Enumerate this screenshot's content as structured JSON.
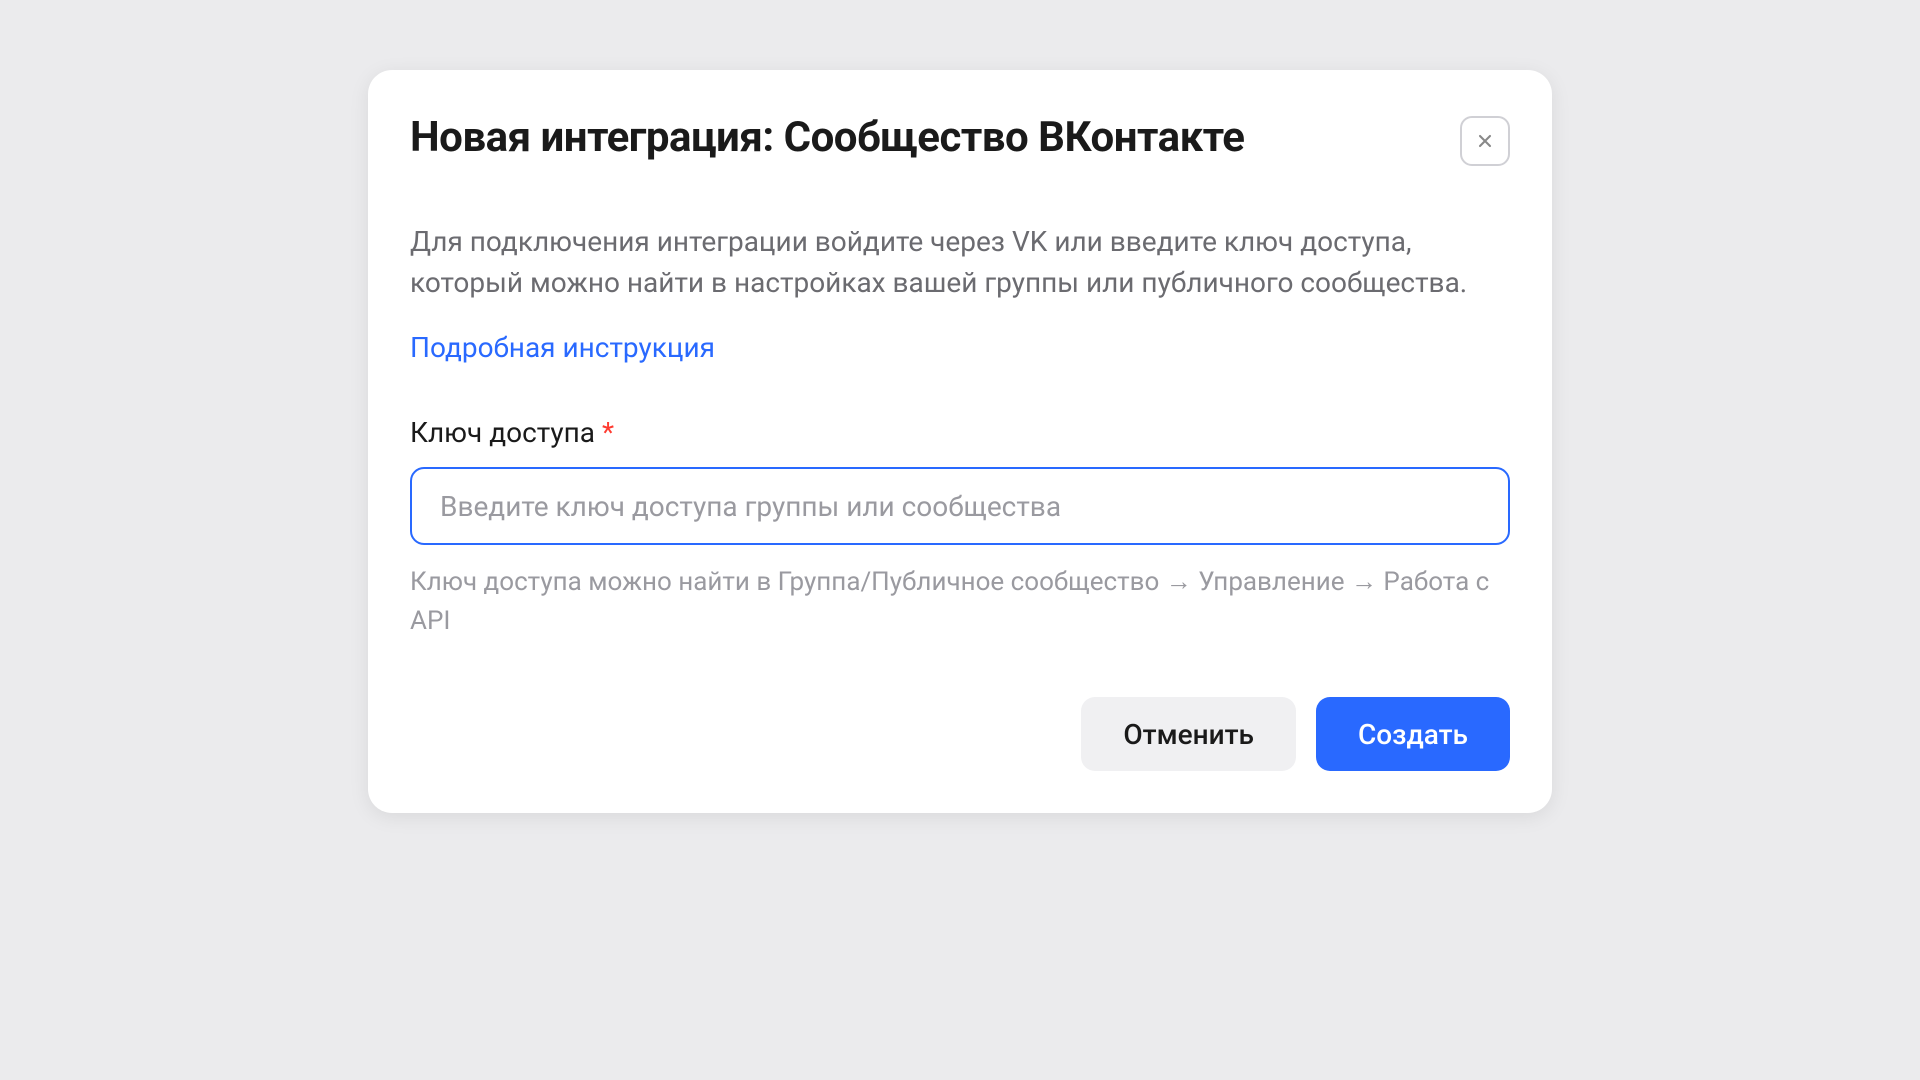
{
  "modal": {
    "title": "Новая интеграция: Сообщество ВКонтакте",
    "description": "Для подключения интеграции войдите через VK или введите ключ доступа, который можно найти в настройках вашей группы или публичного сообщества.",
    "help_link": "Подробная инструкция",
    "field": {
      "label": "Ключ доступа",
      "required_mark": "*",
      "placeholder": "Введите ключ доступа группы или сообщества",
      "value": "",
      "help_text": "Ключ доступа можно найти в Группа/Публичное сообщество → Управление → Работа с API"
    },
    "buttons": {
      "cancel": "Отменить",
      "create": "Создать"
    }
  }
}
